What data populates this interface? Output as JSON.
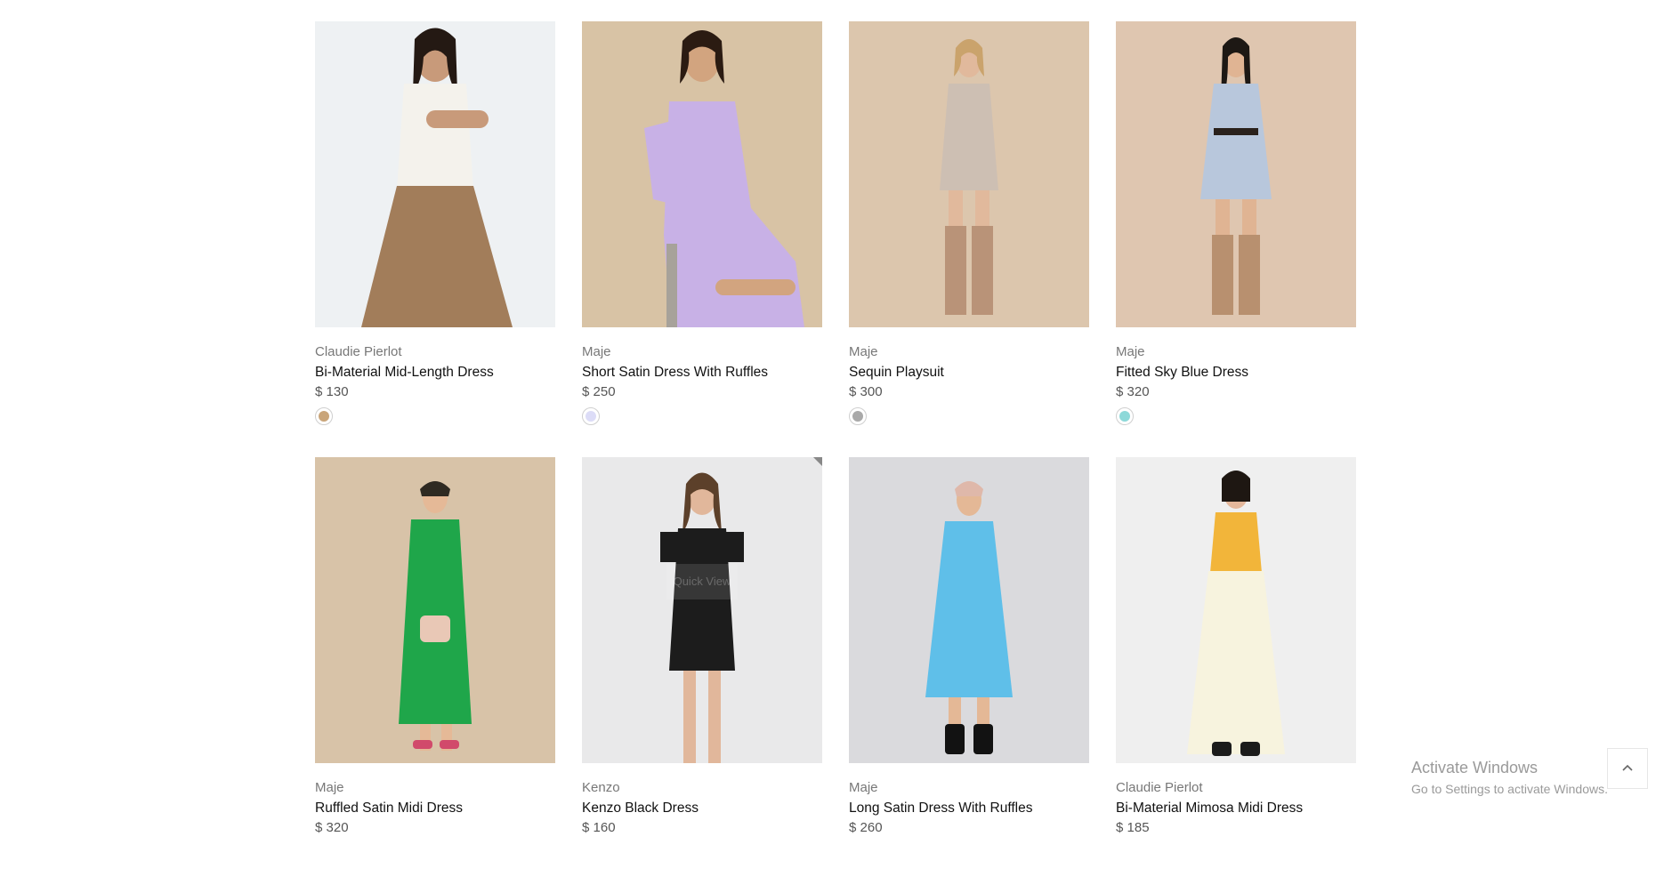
{
  "products": [
    {
      "brand": "Claudie Pierlot",
      "name": "Bi-Material Mid-Length Dress",
      "price": "$ 130",
      "swatch": "#c9a57a",
      "bg": "#eef1f3",
      "dress": "#a27d5a",
      "top": "#f4f2ec"
    },
    {
      "brand": "Maje",
      "name": "Short Satin Dress With Ruffles",
      "price": "$ 250",
      "swatch": "#dcdcf7",
      "bg": "#d8c3a5",
      "dress": "#c8b1e6",
      "top": "#c8b1e6"
    },
    {
      "brand": "Maje",
      "name": "Sequin Playsuit",
      "price": "$ 300",
      "swatch": "#a9a9a9",
      "bg": "#dcc6ad",
      "dress": "#cdbfb3",
      "top": "#cdbfb3"
    },
    {
      "brand": "Maje",
      "name": "Fitted Sky Blue Dress",
      "price": "$ 320",
      "swatch": "#8dd9d9",
      "bg": "#dfc6b0",
      "dress": "#b8c7dc",
      "top": "#b8c7dc"
    },
    {
      "brand": "Maje",
      "name": "Ruffled Satin Midi Dress",
      "price": "$ 320",
      "swatch": "",
      "bg": "#d8c3a8",
      "dress": "#1fa64a",
      "top": "#1fa64a"
    },
    {
      "brand": "Kenzo",
      "name": "Kenzo Black Dress",
      "price": "$ 160",
      "swatch": "",
      "bg": "#e9e9ea",
      "dress": "#1c1c1c",
      "top": "#1c1c1c"
    },
    {
      "brand": "Maje",
      "name": "Long Satin Dress With Ruffles",
      "price": "$ 260",
      "swatch": "",
      "bg": "#dadadd",
      "dress": "#5fbfe9",
      "top": "#5fbfe9"
    },
    {
      "brand": "Claudie Pierlot",
      "name": "Bi-Material Mimosa Midi Dress",
      "price": "$ 185",
      "swatch": "",
      "bg": "#efefef",
      "dress": "#f7f3de",
      "top": "#f2b53a"
    }
  ],
  "quick_view_label": "Quick View",
  "activate_windows": {
    "title": "Activate Windows",
    "subtitle": "Go to Settings to activate Windows."
  },
  "scroll_top_icon": "chevron-up-icon"
}
